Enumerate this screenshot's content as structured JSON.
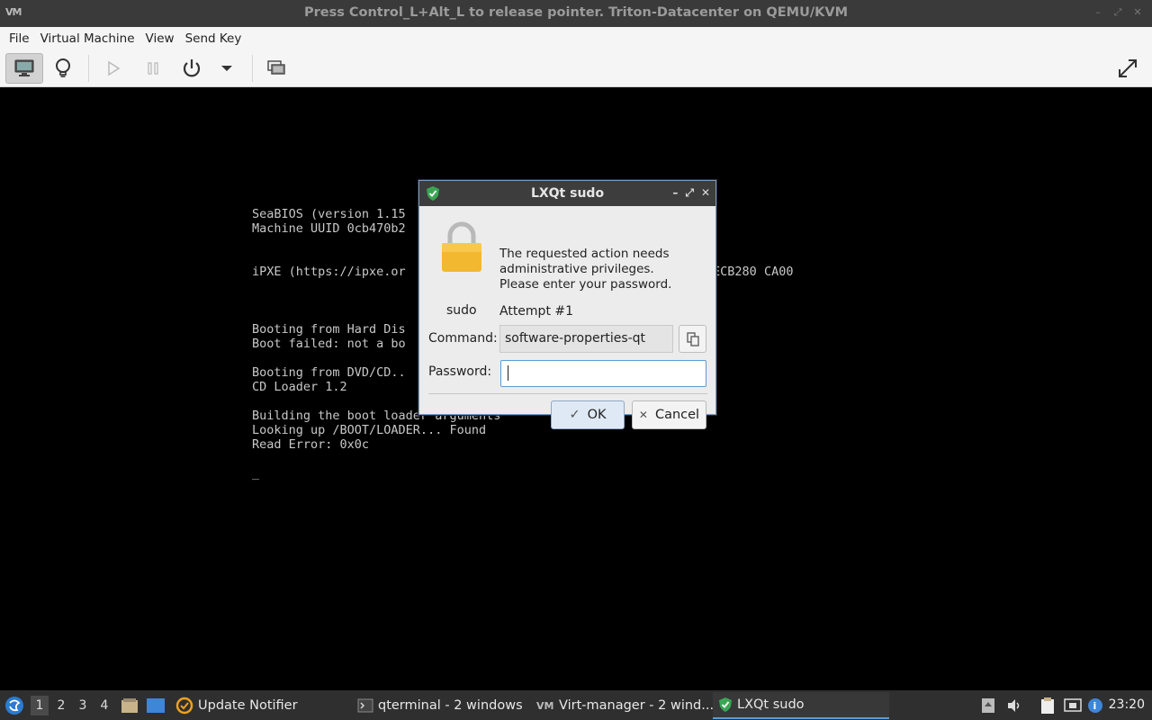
{
  "window": {
    "title": "Press Control_L+Alt_L to release pointer. Triton-Datacenter on QEMU/KVM",
    "logo_text": "VM"
  },
  "menubar": {
    "items": [
      "File",
      "Virtual Machine",
      "View",
      "Send Key"
    ]
  },
  "toolbar": {
    "buttons": [
      "console-icon",
      "lightbulb-icon",
      "play-icon",
      "pause-icon",
      "power-icon",
      "dropdown-arrow-icon",
      "screenshot-icon",
      "fullscreen-icon"
    ]
  },
  "console": {
    "lines": [
      "SeaBIOS (version 1.15",
      "Machine UUID 0cb470b2",
      "",
      "",
      "iPXE (https://ipxe.or                                   0280+BFECB280 CA00",
      "",
      "",
      "",
      "Booting from Hard Dis",
      "Boot failed: not a bo",
      "",
      "Booting from DVD/CD..",
      "CD Loader 1.2",
      "",
      "Building the boot loader arguments",
      "Looking up /BOOT/LOADER... Found",
      "Read Error: 0x0c",
      "",
      "_"
    ]
  },
  "dialog": {
    "title": "LXQt sudo",
    "icon_label": "sudo",
    "message_lines": [
      "The requested action needs",
      "administrative privileges.",
      "Please enter your password."
    ],
    "attempt": "Attempt #1",
    "command_label": "Command:",
    "command_value": "software-properties-qt",
    "password_label": "Password:",
    "password_value": "",
    "ok_label": "OK",
    "cancel_label": "Cancel"
  },
  "taskbar": {
    "workspaces": [
      "1",
      "2",
      "3",
      "4"
    ],
    "current_workspace": "1",
    "tasks": [
      {
        "label": "Update Notifier",
        "icon": "update-notifier-icon"
      },
      {
        "label": "qterminal - 2 windows",
        "icon": "terminal-icon"
      },
      {
        "label": "Virt-manager - 2 wind...",
        "icon": "virt-manager-icon"
      },
      {
        "label": "LXQt sudo",
        "icon": "shield-icon"
      }
    ],
    "clock": "23:20"
  }
}
